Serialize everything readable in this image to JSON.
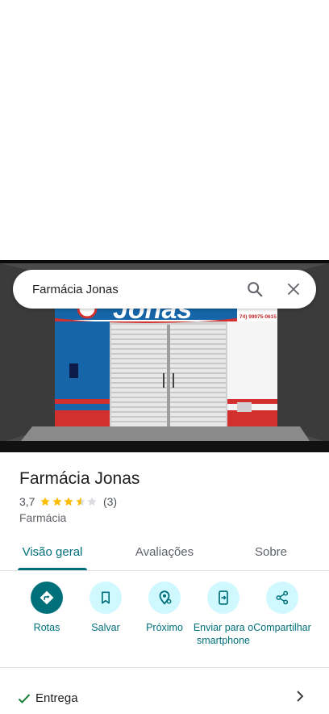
{
  "search": {
    "query": "Farmácia Jonas"
  },
  "hero_photo": {
    "sign_text": "Jonas",
    "phone_text": "74) 99975-0615"
  },
  "place": {
    "name": "Farmácia Jonas",
    "rating": "3,7",
    "rating_value": 3.7,
    "rating_max": 5,
    "review_count": "(3)",
    "category": "Farmácia"
  },
  "tabs": [
    {
      "label": "Visão geral",
      "active": true
    },
    {
      "label": "Avaliações",
      "active": false
    },
    {
      "label": "Sobre",
      "active": false
    }
  ],
  "actions": [
    {
      "label": "Rotas",
      "icon": "directions-icon"
    },
    {
      "label": "Salvar",
      "icon": "bookmark-icon"
    },
    {
      "label": "Próximo",
      "icon": "nearby-icon"
    },
    {
      "label": "Enviar para o smartphone",
      "icon": "send-to-phone-icon"
    },
    {
      "label": "Compartilhar",
      "icon": "share-icon"
    }
  ],
  "details": {
    "delivery_label": "Entrega"
  },
  "colors": {
    "accent": "#00707a",
    "action_bg": "#d0f8ff",
    "star": "#fbbc04",
    "star_empty": "#dadce0"
  }
}
